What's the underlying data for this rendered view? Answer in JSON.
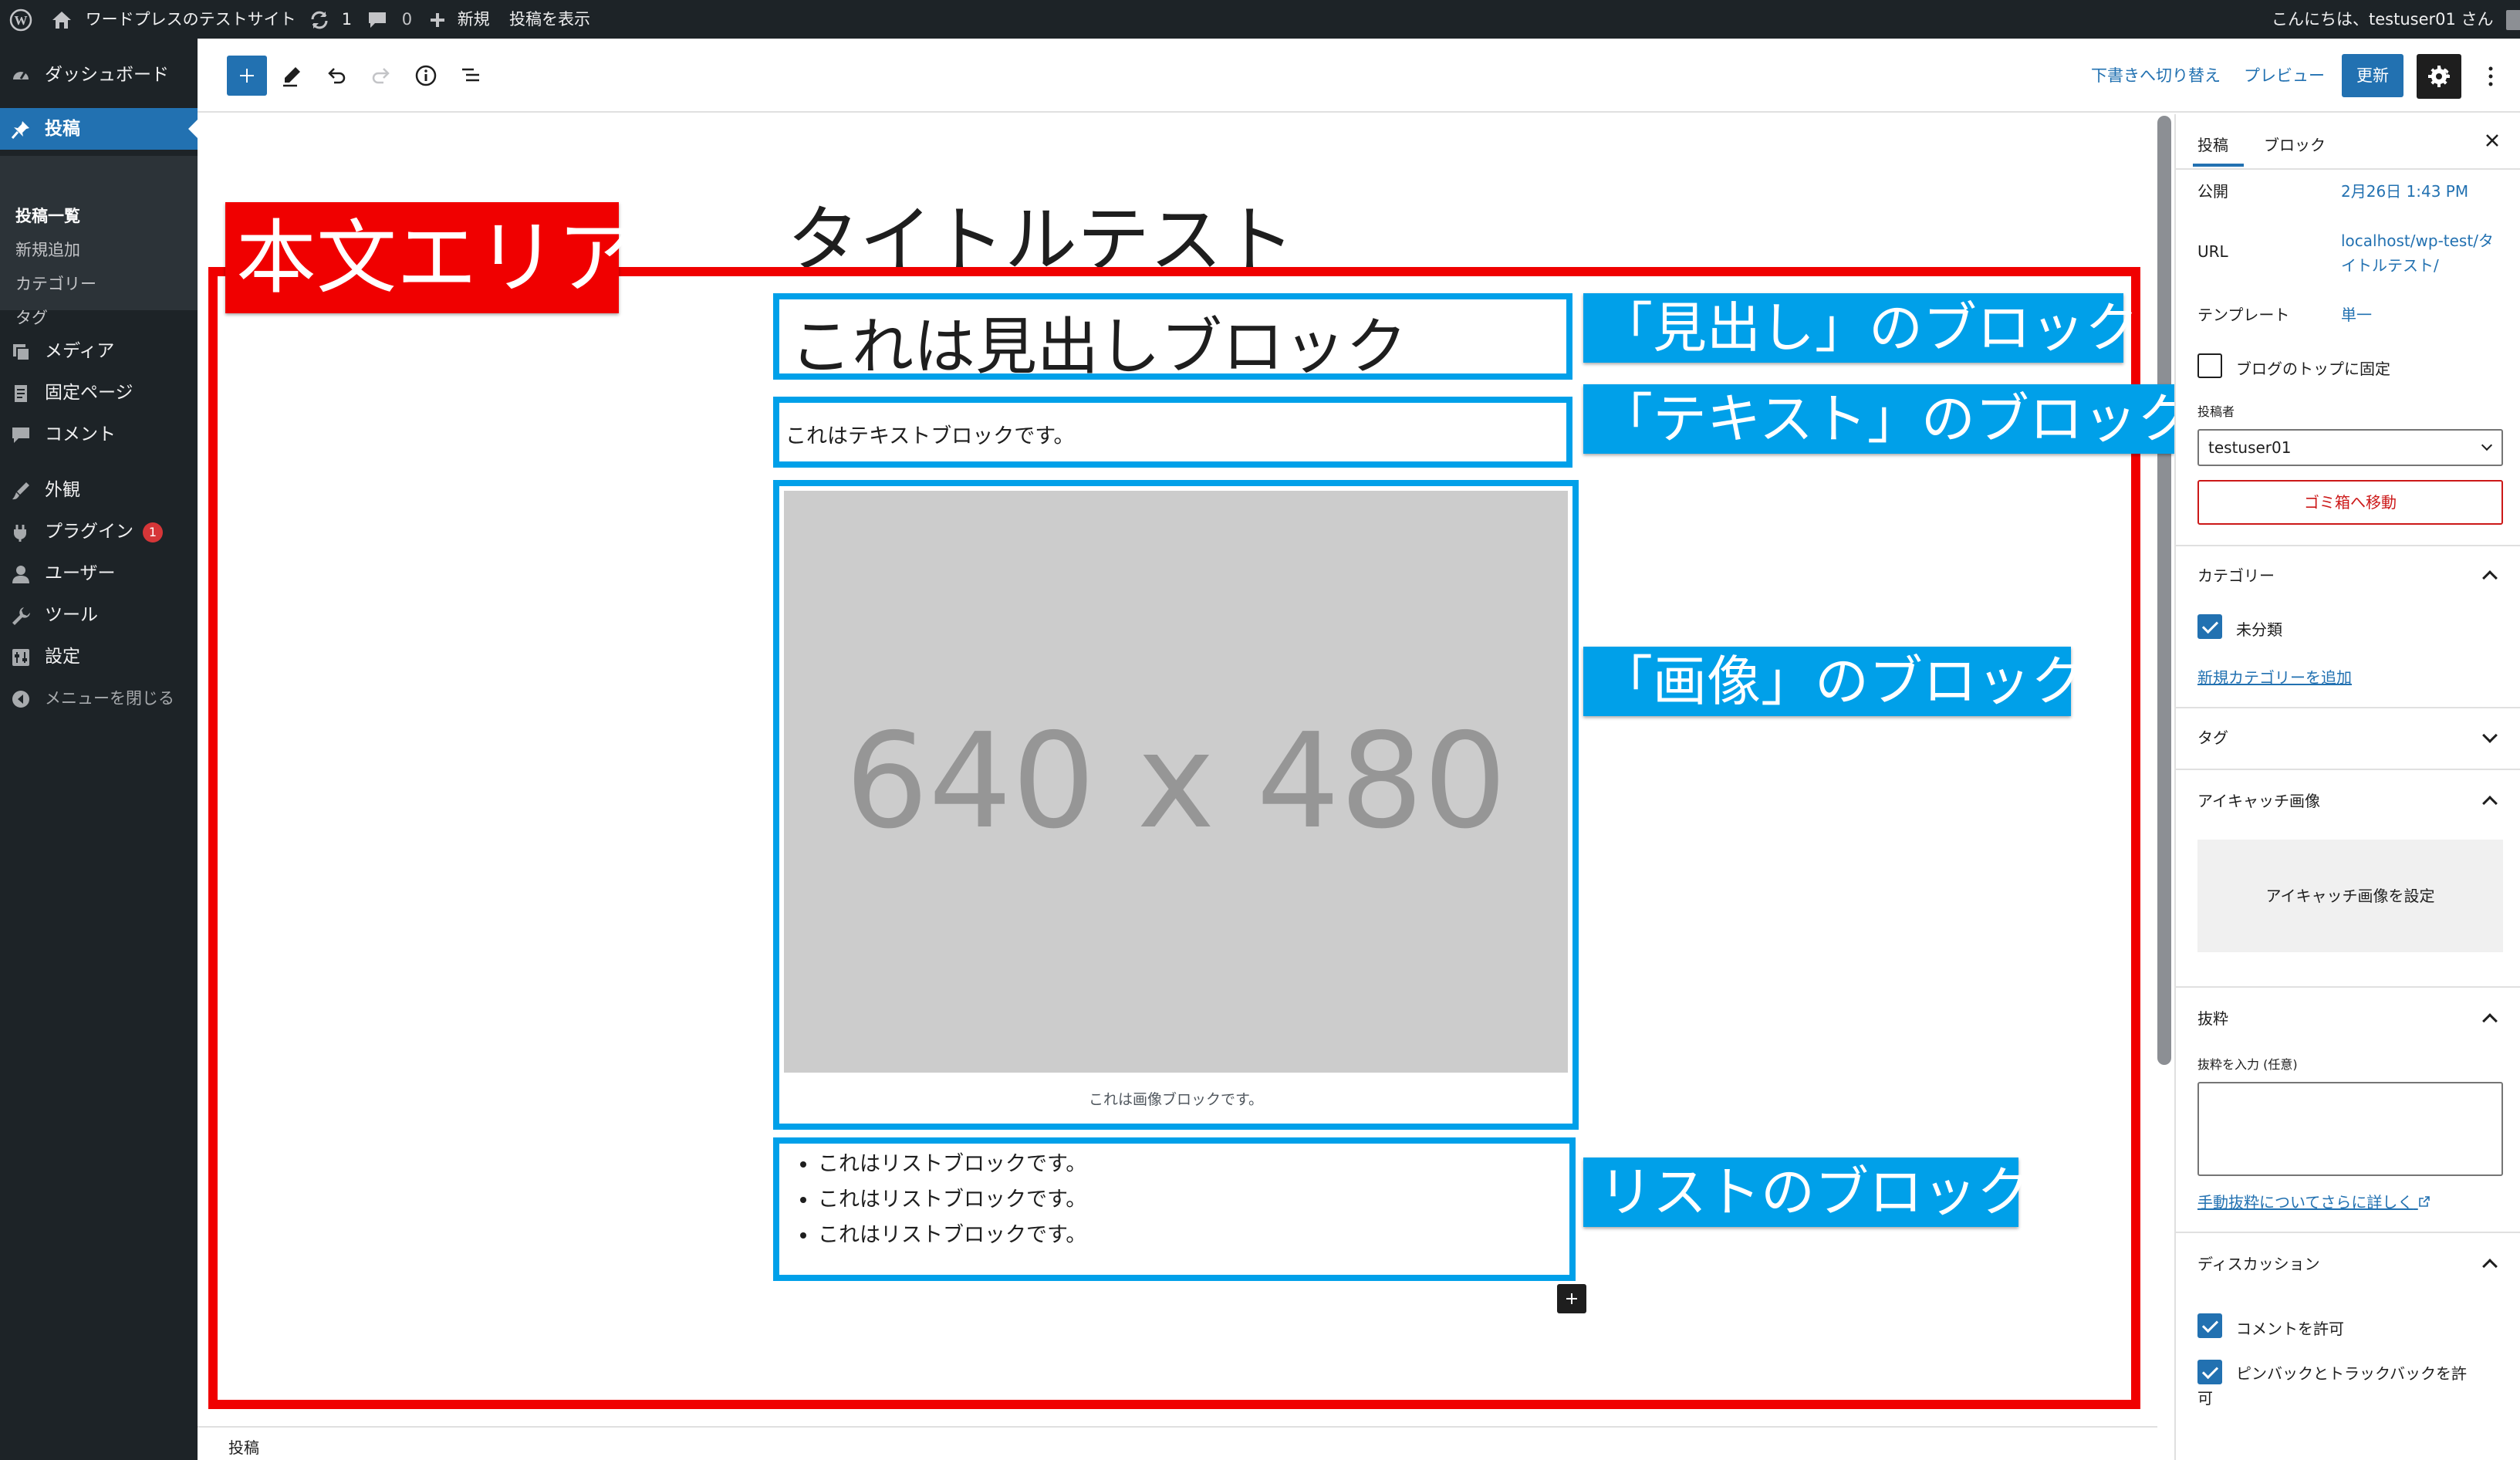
{
  "admin_bar": {
    "site_name": "ワードプレスのテストサイト",
    "updates_count": "1",
    "comments_count": "0",
    "new_label": "新規",
    "view_post": "投稿を表示",
    "greeting": "こんにちは、testuser01 さん"
  },
  "sidebar": {
    "dashboard": "ダッシュボード",
    "posts": "投稿",
    "submenu": [
      "投稿一覧",
      "新規追加",
      "カテゴリー",
      "タグ"
    ],
    "media": "メディア",
    "pages": "固定ページ",
    "comments": "コメント",
    "appearance": "外観",
    "plugins": "プラグイン",
    "plugins_badge": "1",
    "users": "ユーザー",
    "tools": "ツール",
    "settings": "設定",
    "collapse": "メニューを閉じる"
  },
  "toolbar": {
    "switch_to_draft": "下書きへ切り替え",
    "preview": "プレビュー",
    "update": "更新"
  },
  "editor": {
    "post_title": "タイトルテスト",
    "heading_block": "これは見出しブロック",
    "text_block": "これはテキストブロックです。",
    "image_placeholder": "640 x 480",
    "image_caption": "これは画像ブロックです。",
    "list_items": [
      "これはリストブロックです。",
      "これはリストブロックです。",
      "これはリストブロックです。"
    ]
  },
  "annotations": {
    "body_area": "本文エリア",
    "heading_label": "「見出し」のブロック",
    "text_label": "「テキスト」のブロック",
    "image_label": "「画像」のブロック",
    "list_label": "リストのブロック"
  },
  "footer": {
    "breadcrumb": "投稿"
  },
  "panel": {
    "tabs": [
      "投稿",
      "ブロック"
    ],
    "publish_label": "公開",
    "publish_value": "2月26日 1:43 PM",
    "url_label": "URL",
    "url_value_line1": "localhost/wp-test/タ",
    "url_value_line2": "イトルテスト/",
    "template_label": "テンプレート",
    "template_value": "単一",
    "sticky_label": "ブログのトップに固定",
    "author_label": "投稿者",
    "author_value": "testuser01",
    "trash_button": "ゴミ箱へ移動",
    "categories_title": "カテゴリー",
    "category_item": "未分類",
    "add_category_link": "新規カテゴリーを追加",
    "tags_title": "タグ",
    "featured_image_title": "アイキャッチ画像",
    "set_featured_image": "アイキャッチ画像を設定",
    "excerpt_title": "抜粋",
    "excerpt_input_label": "抜粋を入力 (任意)",
    "excerpt_help_link": "手動抜粋についてさらに詳しく",
    "discussion_title": "ディスカッション",
    "allow_comments": "コメントを許可",
    "allow_pingbacks_line1": "ピンバックとトラックバックを許",
    "allow_pingbacks_line2": "可"
  },
  "colors": {
    "admin_dark": "#1d2327",
    "wp_blue": "#2271b1",
    "annotation_blue": "#00a0e9",
    "annotation_red": "#f00000",
    "trash_red": "#cc1818"
  },
  "icons": [
    "wordpress-logo-icon",
    "home-icon",
    "updates-icon",
    "comment-icon",
    "plus-icon",
    "dashboard-icon",
    "pin-icon",
    "media-icon",
    "page-icon",
    "appearance-icon",
    "plugin-icon",
    "user-icon",
    "wrench-icon",
    "settings-icon",
    "collapse-icon",
    "pencil-icon",
    "undo-icon",
    "redo-icon",
    "info-icon",
    "list-view-icon",
    "gear-icon",
    "more-vertical-icon",
    "close-icon",
    "chevron-up-icon",
    "chevron-down-icon",
    "external-link-icon"
  ]
}
